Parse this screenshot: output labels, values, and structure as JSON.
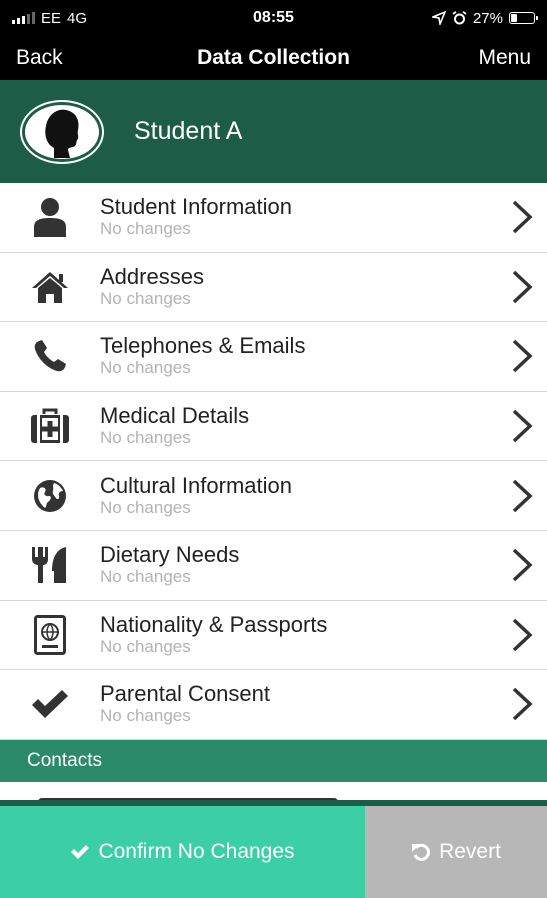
{
  "status_bar": {
    "carrier": "EE",
    "network": "4G",
    "time": "08:55",
    "battery": "27%",
    "battery_level": 0.27
  },
  "nav": {
    "back": "Back",
    "title": "Data Collection",
    "menu": "Menu"
  },
  "student": {
    "name": "Student A"
  },
  "items": [
    {
      "title": "Student Information",
      "subtitle": "No changes",
      "icon": "person-icon"
    },
    {
      "title": "Addresses",
      "subtitle": "No changes",
      "icon": "home-icon"
    },
    {
      "title": "Telephones & Emails",
      "subtitle": "No changes",
      "icon": "phone-icon"
    },
    {
      "title": "Medical Details",
      "subtitle": "No changes",
      "icon": "medical-kit-icon"
    },
    {
      "title": "Cultural Information",
      "subtitle": "No changes",
      "icon": "globe-icon"
    },
    {
      "title": "Dietary Needs",
      "subtitle": "No changes",
      "icon": "cutlery-icon"
    },
    {
      "title": "Nationality & Passports",
      "subtitle": "No changes",
      "icon": "passport-icon"
    },
    {
      "title": "Parental Consent",
      "subtitle": "No changes",
      "icon": "checkmark-icon"
    }
  ],
  "contacts": {
    "header": "Contacts"
  },
  "actions": {
    "confirm": "Confirm No Changes",
    "revert": "Revert"
  },
  "colors": {
    "header_green": "#1d5d47",
    "section_green": "#2a8a69",
    "confirm_teal": "#3ccfa6",
    "revert_grey": "#b7b7b7",
    "icon_dark": "#333333"
  }
}
